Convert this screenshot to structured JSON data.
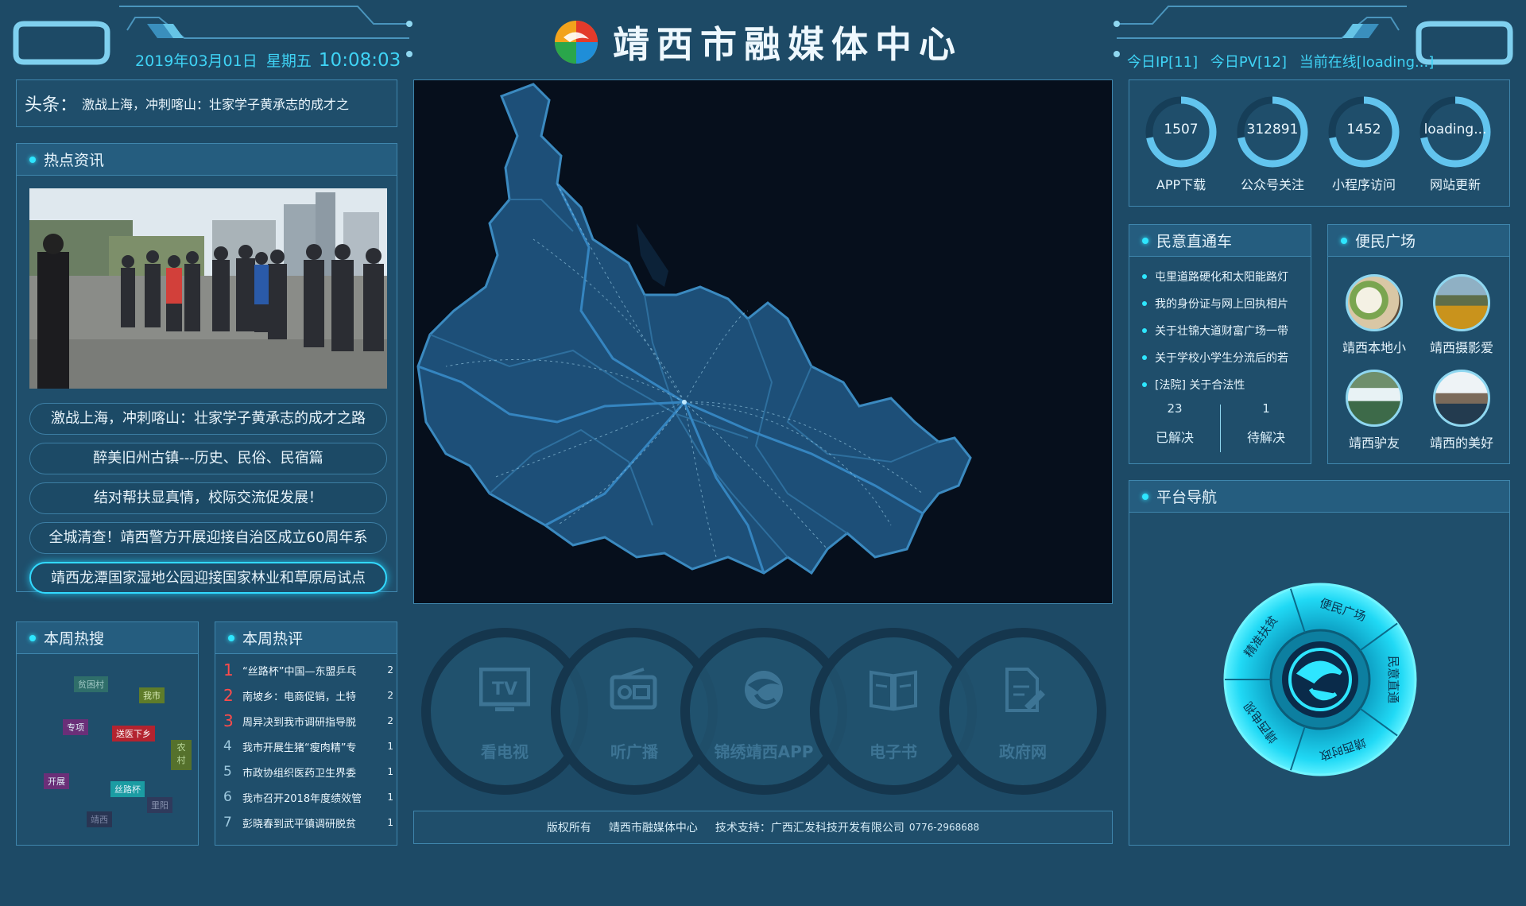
{
  "header": {
    "title": "靖西市融媒体中心",
    "date": "2019年03月01日",
    "weekday": "星期五",
    "time": "10:08:03",
    "ip": "今日IP[11]",
    "pv": "今日PV[12]",
    "online": "当前在线[loading...]"
  },
  "headline": {
    "label": "头条：",
    "text": "激战上海，冲刺喀山：壮家学子黄承志的成才之"
  },
  "hot_news": {
    "title": "热点资讯",
    "items": [
      "激战上海，冲刺喀山：壮家学子黄承志的成才之路",
      "醉美旧州古镇---历史、民俗、民宿篇",
      "结对帮扶显真情，校际交流促发展！",
      "全城清查！靖西警方开展迎接自治区成立60周年系",
      "靖西龙潭国家湿地公园迎接国家林业和草原局试点"
    ]
  },
  "weekly_search": {
    "title": "本周热搜",
    "tags": [
      "贫困村",
      "我市",
      "专项",
      "送医下乡",
      "农村",
      "开展",
      "丝路杯",
      "里阳",
      "靖西"
    ]
  },
  "weekly_comments": {
    "title": "本周热评",
    "rows": [
      {
        "rank": "1",
        "text": "“丝路杯”中国—东盟乒乓",
        "count": "2"
      },
      {
        "rank": "2",
        "text": "南坡乡：电商促销，土特",
        "count": "2"
      },
      {
        "rank": "3",
        "text": "周异决到我市调研指导脱",
        "count": "2"
      },
      {
        "rank": "4",
        "text": "我市开展生猪“瘦肉精”专",
        "count": "1"
      },
      {
        "rank": "5",
        "text": "市政协组织医药卫生界委",
        "count": "1"
      },
      {
        "rank": "6",
        "text": "我市召开2018年度绩效管",
        "count": "1"
      },
      {
        "rank": "7",
        "text": "彭晓春到武平镇调研脱贫",
        "count": "1"
      }
    ]
  },
  "services": [
    {
      "label": "看电视",
      "icon": "tv-icon"
    },
    {
      "label": "听广播",
      "icon": "radio-icon"
    },
    {
      "label": "锦绣靖西APP",
      "icon": "app-logo-icon"
    },
    {
      "label": "电子书",
      "icon": "book-icon"
    },
    {
      "label": "政府网",
      "icon": "document-edit-icon"
    }
  ],
  "footer": {
    "copyright": "版权所有",
    "owner": "靖西市融媒体中心",
    "support": "技术支持：广西汇发科技开发有限公司",
    "phone": "0776-2968688"
  },
  "stats": [
    {
      "value": "1507",
      "label": "APP下载",
      "progress": 0.72
    },
    {
      "value": "312891",
      "label": "公众号关注",
      "progress": 0.72
    },
    {
      "value": "1452",
      "label": "小程序访问",
      "progress": 0.72
    },
    {
      "value": "loading...",
      "label": "网站更新",
      "progress": 0.72
    }
  ],
  "opinion": {
    "title": "民意直通车",
    "items": [
      "屯里道路硬化和太阳能路灯",
      "我的身份证与网上回执相片",
      "关于壮锦大道财富广场一带",
      "关于学校小学生分流后的若",
      "[法院] 关于合法性"
    ],
    "solved": {
      "value": "23",
      "label": "已解决"
    },
    "pending": {
      "value": "1",
      "label": "待解决"
    }
  },
  "convenience": {
    "title": "便民广场",
    "items": [
      "靖西本地小",
      "靖西摄影爱",
      "靖西驴友",
      "靖西的美好"
    ]
  },
  "platform": {
    "title": "平台导航",
    "segments": [
      "便民广场",
      "民意直通",
      "靖西时政",
      "靖西电视",
      "精准扶贫"
    ]
  },
  "colors": {
    "background": "#1d4a66",
    "accent": "#2ee6ff",
    "border": "#3f86ad",
    "map_bg": "#060f1c",
    "map_fill": "#1d4f78"
  }
}
